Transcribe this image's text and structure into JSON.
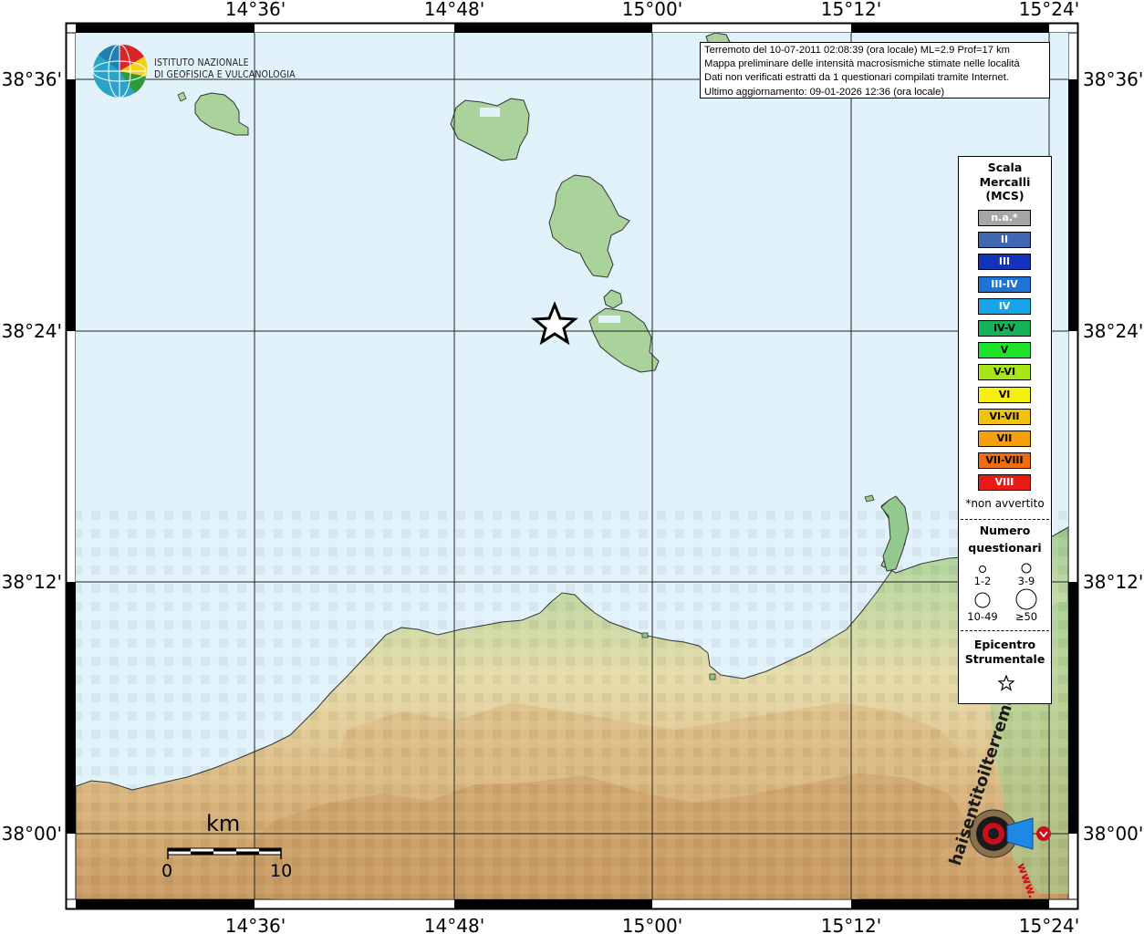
{
  "map": {
    "top_axis_labels": [
      "14°36'",
      "14°48'",
      "15°00'",
      "15°12'",
      "15°24'"
    ],
    "bottom_axis_labels": [
      "14°36'",
      "14°48'",
      "15°00'",
      "15°12'",
      "15°24'"
    ],
    "left_axis_labels": [
      "38°36'",
      "38°24'",
      "38°12'",
      "38°00'"
    ],
    "right_axis_labels": [
      "38°36'",
      "38°24'",
      "38°12'",
      "38°00'"
    ],
    "sea_color": "#e1f2fb",
    "land_colors": [
      "#94c98d",
      "#e7dcaa",
      "#c99a63"
    ]
  },
  "logo": {
    "line1": "ISTITUTO NAZIONALE",
    "line2": "DI GEOFISICA E VULCANOLOGIA"
  },
  "info": {
    "line1": "Terremoto del 10-07-2011 02:08:39 (ora locale) ML=2.9 Prof=17 km",
    "line2": "Mappa preliminare delle intensità macrosismiche stimate nelle località",
    "line3": "Dati non verificati estratti da 1 questionari compilati tramite Internet.",
    "line4": "Ultimo aggiornamento: 09-01-2026 12:36 (ora locale)"
  },
  "legend": {
    "title": [
      "Scala",
      "Mercalli",
      "(MCS)"
    ],
    "items": [
      {
        "label": "n.a.*",
        "color": "#a6a6a6"
      },
      {
        "label": "II",
        "color": "#4267b2"
      },
      {
        "label": "III",
        "color": "#1433b8"
      },
      {
        "label": "III-IV",
        "color": "#1f73d6"
      },
      {
        "label": "IV",
        "color": "#18a4e8"
      },
      {
        "label": "IV-V",
        "color": "#14b35a"
      },
      {
        "label": "V",
        "color": "#1ee12a"
      },
      {
        "label": "V-VI",
        "color": "#a6e61a"
      },
      {
        "label": "VI",
        "color": "#f5f010"
      },
      {
        "label": "VI-VII",
        "color": "#f2c20f"
      },
      {
        "label": "VII",
        "color": "#f5a00c"
      },
      {
        "label": "VII-VIII",
        "color": "#ee6d12"
      },
      {
        "label": "VIII",
        "color": "#ea1a16"
      }
    ],
    "note": "*non avvertito",
    "questionari_title": [
      "Numero",
      "questionari"
    ],
    "questionari_sizes": [
      "1-2",
      "3-9",
      "10-49",
      "≥50"
    ],
    "epicentro_title": [
      "Epicentro",
      "Strumentale"
    ]
  },
  "scale_bar": {
    "unit": "km",
    "start": "0",
    "end": "10"
  },
  "badge": {
    "text": "haisentitoilterremoto.it",
    "prefix": "www."
  }
}
